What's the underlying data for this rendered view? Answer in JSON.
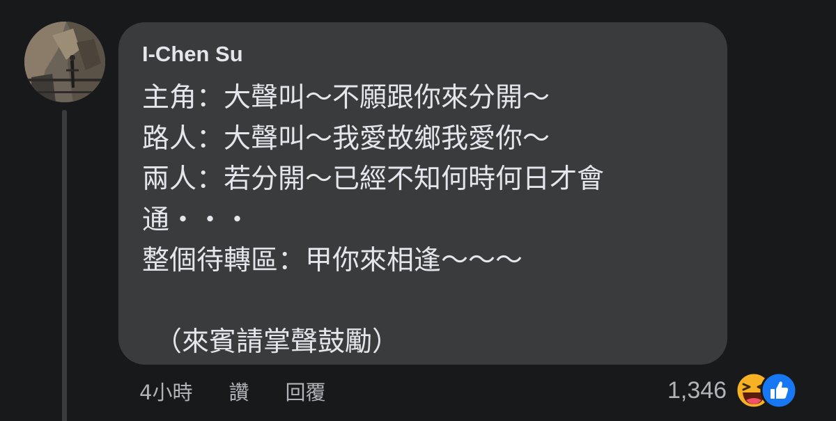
{
  "comment": {
    "author": "I-Chen Su",
    "lines": [
      "主角：大聲叫～不願跟你來分開～",
      "路人：大聲叫～我愛故鄉我愛你～",
      "兩人：若分開～已經不知何時何日才會",
      "通・・・",
      "整個待轉區：甲你來相逢～～～",
      "",
      "（來賓請掌聲鼓勵）"
    ],
    "time": "4小時",
    "like_label": "讚",
    "reply_label": "回覆",
    "reaction_count": "1,346",
    "reactions": [
      "haha-icon",
      "like-icon"
    ]
  },
  "colors": {
    "background": "#18191a",
    "bubble": "#3a3b3c",
    "text": "#e4e6eb",
    "meta": "#b0b3b8",
    "like_blue": "#1877f2",
    "haha_yellow": "#f7b125"
  }
}
